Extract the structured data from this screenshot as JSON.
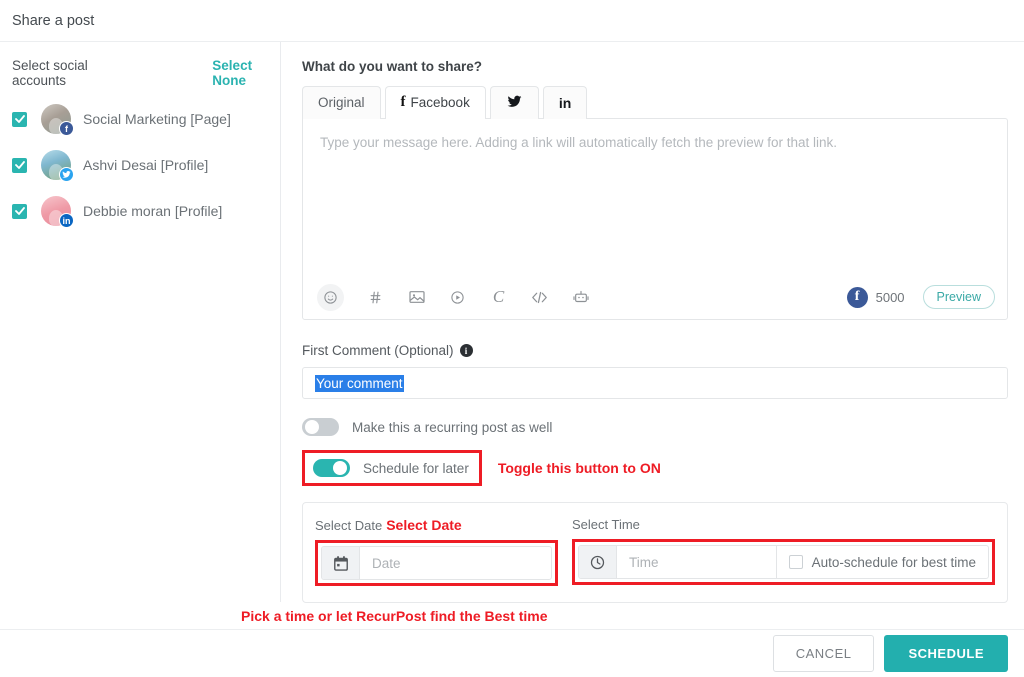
{
  "header": {
    "title": "Share a post"
  },
  "sidebar": {
    "title": "Select social accounts",
    "select_none": "Select None",
    "accounts": [
      {
        "name": "Social Marketing [Page]",
        "network": "facebook",
        "checked": true
      },
      {
        "name": "Ashvi Desai [Profile]",
        "network": "twitter",
        "checked": true
      },
      {
        "name": "Debbie moran [Profile]",
        "network": "linkedin",
        "checked": true
      }
    ]
  },
  "composer": {
    "question": "What do you want to share?",
    "tabs": [
      {
        "label": "Original",
        "icon": "",
        "active": false
      },
      {
        "label": "Facebook",
        "icon": "facebook-f-icon",
        "active": true
      },
      {
        "label": "",
        "icon": "twitter-bird-icon",
        "active": false
      },
      {
        "label": "",
        "icon": "linkedin-in-icon",
        "active": false
      }
    ],
    "placeholder": "Type your message here. Adding a link will automatically fetch the preview for that link.",
    "toolbar_icons": [
      "emoji-icon",
      "hashtag-icon",
      "image-icon",
      "video-icon",
      "canva-icon",
      "code-icon",
      "robot-icon"
    ],
    "char_count": "5000",
    "count_network": "facebook",
    "preview_label": "Preview"
  },
  "first_comment": {
    "label": "First Comment (Optional)",
    "info_icon": "info-icon",
    "value": "Your comment"
  },
  "toggles": {
    "recurring": {
      "label": "Make this a recurring post as well",
      "on": false
    },
    "schedule_later": {
      "label": "Schedule for later",
      "on": true
    },
    "schedule_annotation": "Toggle this button to ON"
  },
  "datetime": {
    "date_label": "Select Date",
    "date_annotation": "Select Date",
    "date_placeholder": "Date",
    "date_icon": "calendar-icon",
    "time_label": "Select Time",
    "time_placeholder": "Time",
    "time_icon": "clock-icon",
    "auto_schedule_label": "Auto-schedule for best time",
    "auto_schedule_checked": false,
    "bottom_annotation": "Pick a time or let RecurPost find the Best time"
  },
  "footer": {
    "cancel": "CANCEL",
    "schedule": "SCHEDULE"
  },
  "colors": {
    "accent_teal": "#2ab5b0",
    "annotation_red": "#ee1c25",
    "selection_blue": "#2a7fe8",
    "facebook_blue": "#3b5998",
    "twitter_blue": "#2aa3ef",
    "linkedin_blue": "#0a66c2"
  }
}
